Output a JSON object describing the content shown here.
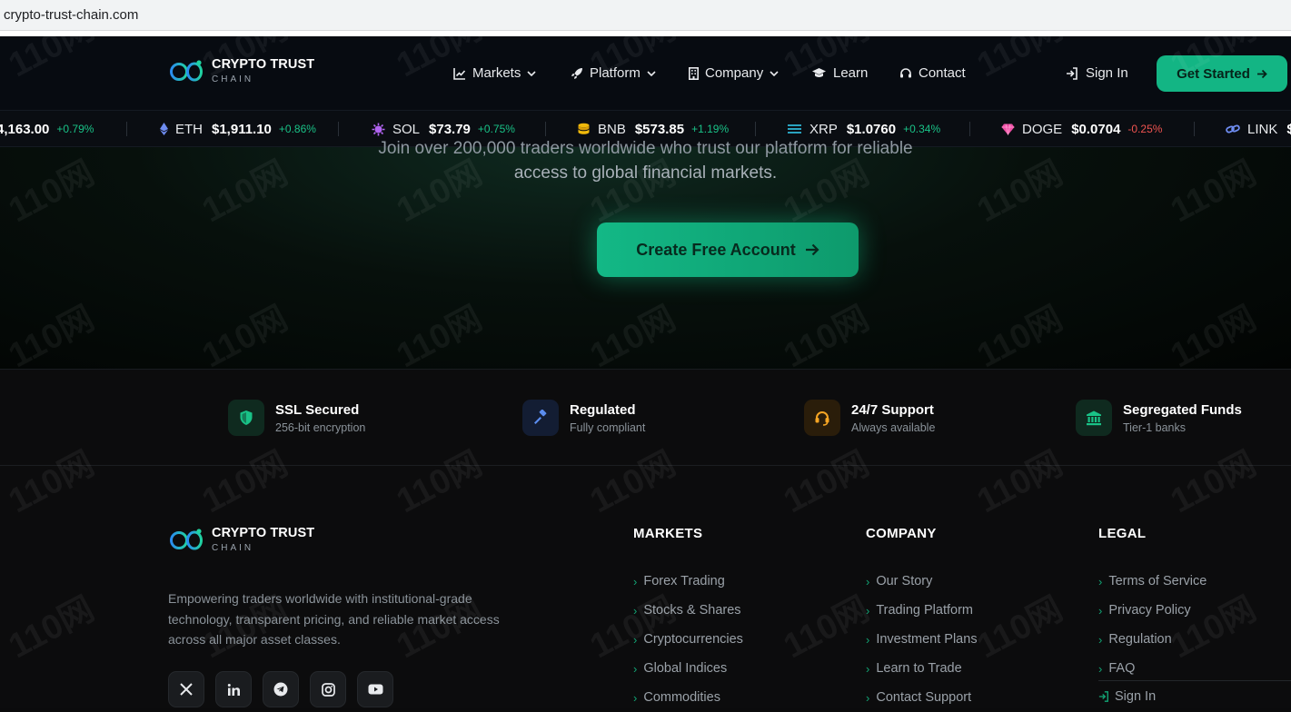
{
  "browser": {
    "url": "crypto-trust-chain.com"
  },
  "brand": {
    "name": "CRYPTO TRUST",
    "sub": "CHAIN"
  },
  "nav": {
    "items": [
      {
        "label": "Markets",
        "icon": "chart-line-icon",
        "dropdown": true
      },
      {
        "label": "Platform",
        "icon": "rocket-icon",
        "dropdown": true
      },
      {
        "label": "Company",
        "icon": "building-icon",
        "dropdown": true
      },
      {
        "label": "Learn",
        "icon": "graduation-cap-icon",
        "dropdown": false
      },
      {
        "label": "Contact",
        "icon": "headset-icon",
        "dropdown": false
      }
    ],
    "signin": "Sign In",
    "cta": "Get Started"
  },
  "ticker": [
    {
      "symbol": "",
      "price": "4,163.00",
      "change": "+0.79%",
      "direction": "up",
      "icon": ""
    },
    {
      "symbol": "ETH",
      "price": "$1,911.10",
      "change": "+0.86%",
      "direction": "up",
      "icon": "ethereum-icon"
    },
    {
      "symbol": "SOL",
      "price": "$73.79",
      "change": "+0.75%",
      "direction": "up",
      "icon": "solana-icon"
    },
    {
      "symbol": "BNB",
      "price": "$573.85",
      "change": "+1.19%",
      "direction": "up",
      "icon": "bnb-coins-icon"
    },
    {
      "symbol": "XRP",
      "price": "$1.0760",
      "change": "+0.34%",
      "direction": "up",
      "icon": "xrp-icon"
    },
    {
      "symbol": "DOGE",
      "price": "$0.0704",
      "change": "-0.25%",
      "direction": "down",
      "icon": "doge-gem-icon"
    },
    {
      "symbol": "LINK",
      "price": "$",
      "change": "",
      "direction": "up",
      "icon": "chain-link-icon"
    }
  ],
  "hero": {
    "line1": "Join over 200,000 traders worldwide who trust our platform for reliable",
    "line2": "access to global financial markets.",
    "cta": "Create Free Account"
  },
  "badges": [
    {
      "title": "SSL Secured",
      "sub": "256-bit encryption",
      "icon": "shield-icon",
      "color": "#19c287"
    },
    {
      "title": "Regulated",
      "sub": "Fully compliant",
      "icon": "gavel-icon",
      "color": "#5b8def"
    },
    {
      "title": "24/7 Support",
      "sub": "Always available",
      "icon": "headset-icon",
      "color": "#f5a524"
    },
    {
      "title": "Segregated Funds",
      "sub": "Tier-1 banks",
      "icon": "bank-icon",
      "color": "#19c287"
    }
  ],
  "footer": {
    "description": "Empowering traders worldwide with institutional-grade technology, transparent pricing, and reliable market access across all major asset classes.",
    "socials": [
      "x-icon",
      "linkedin-icon",
      "telegram-icon",
      "instagram-icon",
      "youtube-icon"
    ],
    "columns": [
      {
        "title": "MARKETS",
        "links": [
          "Forex Trading",
          "Stocks & Shares",
          "Cryptocurrencies",
          "Global Indices",
          "Commodities"
        ]
      },
      {
        "title": "COMPANY",
        "links": [
          "Our Story",
          "Trading Platform",
          "Investment Plans",
          "Learn to Trade",
          "Contact Support"
        ]
      },
      {
        "title": "LEGAL",
        "links": [
          "Terms of Service",
          "Privacy Policy",
          "Regulation",
          "FAQ"
        ]
      }
    ],
    "signin": "Sign In"
  },
  "watermark": "110网",
  "colors": {
    "accent": "#13b584",
    "up": "#19c287",
    "down": "#ef5350",
    "navBg": "#070b11"
  }
}
